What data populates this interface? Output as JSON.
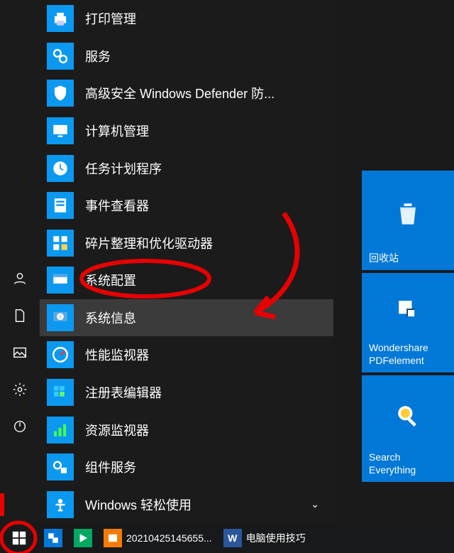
{
  "start_menu": {
    "items": [
      {
        "label": "打印管理",
        "icon": "printer"
      },
      {
        "label": "服务",
        "icon": "services"
      },
      {
        "label": "高级安全 Windows Defender 防...",
        "icon": "shield"
      },
      {
        "label": "计算机管理",
        "icon": "computer"
      },
      {
        "label": "任务计划程序",
        "icon": "clock"
      },
      {
        "label": "事件查看器",
        "icon": "event"
      },
      {
        "label": "碎片整理和优化驱动器",
        "icon": "defrag"
      },
      {
        "label": "系统配置",
        "icon": "sysconfig"
      },
      {
        "label": "系统信息",
        "icon": "sysinfo",
        "hover": true
      },
      {
        "label": "性能监视器",
        "icon": "perf"
      },
      {
        "label": "注册表编辑器",
        "icon": "regedit"
      },
      {
        "label": "资源监视器",
        "icon": "resmon"
      },
      {
        "label": "组件服务",
        "icon": "component"
      },
      {
        "label": "Windows 轻松使用",
        "icon": "ease",
        "expandable": true
      }
    ]
  },
  "rail": {
    "user": "user",
    "documents": "documents",
    "pictures": "pictures",
    "settings": "settings",
    "power": "power"
  },
  "tiles": [
    {
      "label": "回收站",
      "icon": "recycle"
    },
    {
      "label": "Wondershare PDFelement",
      "icon": "pdfelement"
    },
    {
      "label": "Search Everything",
      "icon": "search"
    }
  ],
  "taskbar": {
    "items": [
      {
        "label": "",
        "icon": "pdfelement",
        "cls": ""
      },
      {
        "label": "",
        "icon": "video",
        "cls": "green"
      },
      {
        "label": "20210425145655...",
        "icon": "reader",
        "cls": "orange"
      },
      {
        "label": "电脑使用技巧",
        "icon": "word",
        "cls": "word"
      }
    ]
  }
}
